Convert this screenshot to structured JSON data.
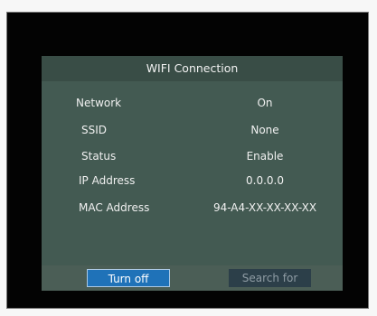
{
  "dialog": {
    "title": "WIFI Connection"
  },
  "rows": [
    {
      "label": "Network",
      "value": "On"
    },
    {
      "label": "SSID",
      "value": "None"
    },
    {
      "label": "Status",
      "value": "Enable"
    },
    {
      "label": "IP Address",
      "value": "0.0.0.0"
    },
    {
      "label": "MAC Address",
      "value": "94-A4-XX-XX-XX-XX"
    }
  ],
  "buttons": {
    "turn_off": "Turn off",
    "search_for": "Search for"
  }
}
